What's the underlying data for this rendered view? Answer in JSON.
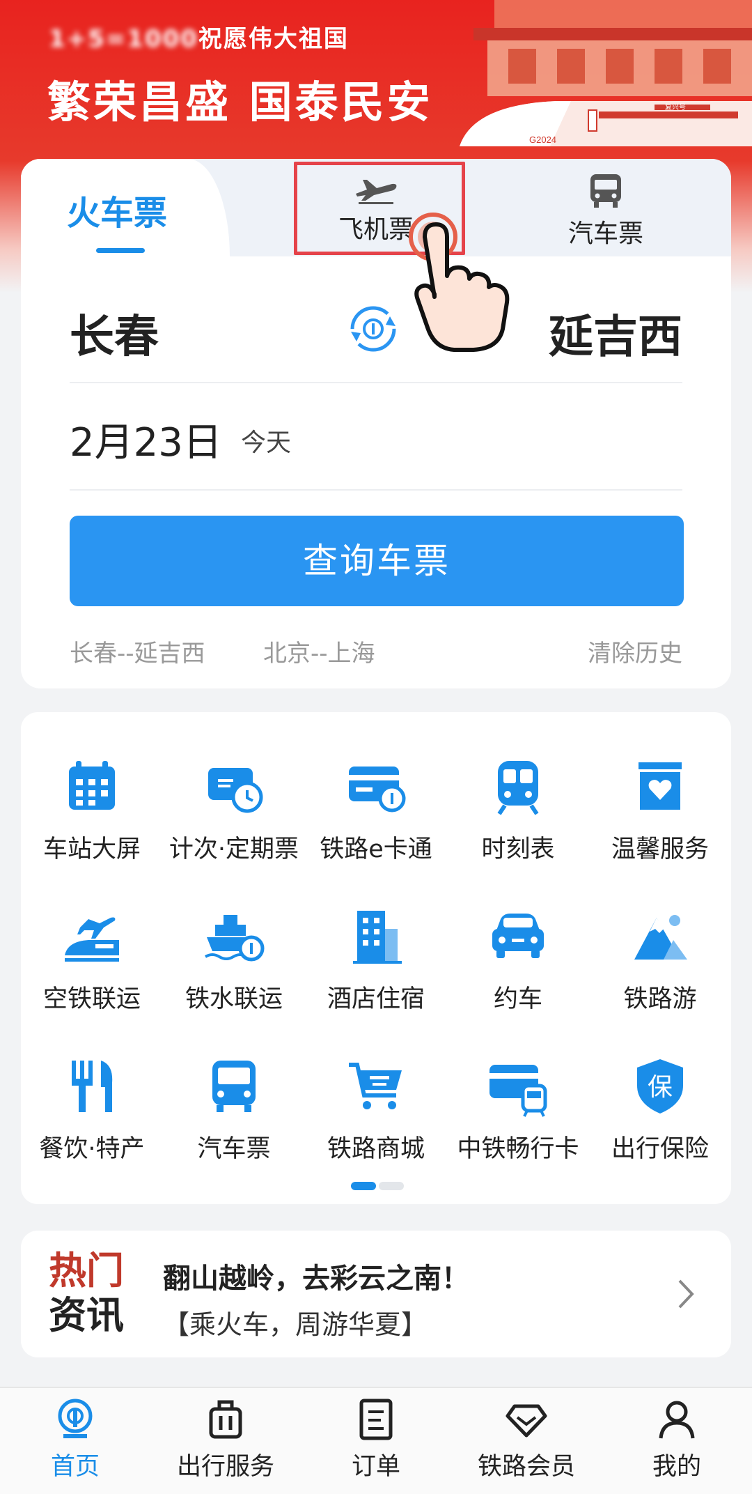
{
  "banner": {
    "subtitle_prefix": "1+5=1000",
    "subtitle": "祝愿伟大祖国",
    "title": "繁荣昌盛  国泰民安",
    "train_code": "G2024",
    "train_plate": "复兴号"
  },
  "ticket_tabs": [
    {
      "label": "火车票",
      "active": true
    },
    {
      "label": "飞机票",
      "active": false
    },
    {
      "label": "汽车票",
      "active": false
    }
  ],
  "route": {
    "from": "长春",
    "to": "延吉西"
  },
  "date": {
    "value": "2月23日",
    "tag": "今天"
  },
  "search_button": "查询车票",
  "history": {
    "items": [
      "长春--延吉西",
      "北京--上海"
    ],
    "clear": "清除历史"
  },
  "services": [
    {
      "label": "车站大屏",
      "icon": "calendar-grid-icon"
    },
    {
      "label": "计次·定期票",
      "icon": "ticket-clock-icon"
    },
    {
      "label": "铁路e卡通",
      "icon": "rail-card-icon"
    },
    {
      "label": "时刻表",
      "icon": "train-front-icon"
    },
    {
      "label": "温馨服务",
      "icon": "heart-box-icon"
    },
    {
      "label": "空铁联运",
      "icon": "plane-train-icon"
    },
    {
      "label": "铁水联运",
      "icon": "ship-icon"
    },
    {
      "label": "酒店住宿",
      "icon": "hotel-building-icon"
    },
    {
      "label": "约车",
      "icon": "car-icon"
    },
    {
      "label": "铁路游",
      "icon": "mountain-icon"
    },
    {
      "label": "餐饮·特产",
      "icon": "fork-knife-icon"
    },
    {
      "label": "汽车票",
      "icon": "bus-icon"
    },
    {
      "label": "铁路商城",
      "icon": "shopping-cart-icon"
    },
    {
      "label": "中铁畅行卡",
      "icon": "card-train-icon"
    },
    {
      "label": "出行保险",
      "icon": "insurance-shield-icon"
    }
  ],
  "services_pager": {
    "current": 1,
    "total": 2
  },
  "news": {
    "badge_line1": "热门",
    "badge_line2": "资讯",
    "title": "翻山越岭，去彩云之南！",
    "subtitle": "【乘火车，周游华夏】"
  },
  "bottom_nav": [
    {
      "label": "首页",
      "active": true,
      "icon": "home-rail-icon"
    },
    {
      "label": "出行服务",
      "active": false,
      "icon": "luggage-icon"
    },
    {
      "label": "订单",
      "active": false,
      "icon": "order-doc-icon"
    },
    {
      "label": "铁路会员",
      "active": false,
      "icon": "diamond-icon"
    },
    {
      "label": "我的",
      "active": false,
      "icon": "user-icon"
    }
  ],
  "colors": {
    "primary": "#1a8de8",
    "button": "#2a95f2",
    "banner_red": "#e8231f",
    "highlight": "#e5434a"
  }
}
